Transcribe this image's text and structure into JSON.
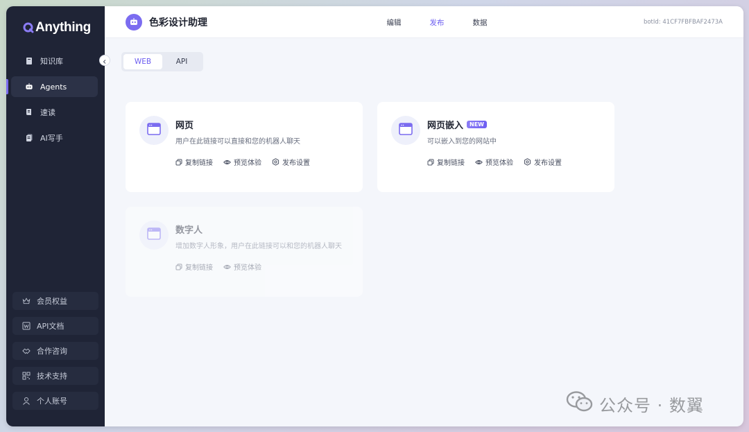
{
  "sidebar": {
    "logo_text": "Anything",
    "items": [
      {
        "label": "知识库",
        "icon": "book-icon",
        "active": false
      },
      {
        "label": "Agents",
        "icon": "robot-icon",
        "active": true
      },
      {
        "label": "速读",
        "icon": "scroll-icon",
        "active": false
      },
      {
        "label": "AI写手",
        "icon": "document-icon",
        "active": false
      }
    ],
    "bottom_items": [
      {
        "label": "会员权益",
        "icon": "crown-icon"
      },
      {
        "label": "API文档",
        "icon": "word-doc-icon"
      },
      {
        "label": "合作咨询",
        "icon": "handshake-icon"
      },
      {
        "label": "技术支持",
        "icon": "qr-code-icon"
      },
      {
        "label": "个人账号",
        "icon": "user-icon"
      }
    ]
  },
  "header": {
    "app_title": "色彩设计助理",
    "tabs": [
      {
        "label": "编辑",
        "active": false
      },
      {
        "label": "发布",
        "active": true
      },
      {
        "label": "数据",
        "active": false
      }
    ],
    "bot_id": "botId: 41CF7FBFBAF2473A"
  },
  "segmented": {
    "options": [
      {
        "label": "WEB",
        "active": true
      },
      {
        "label": "API",
        "active": false
      }
    ]
  },
  "cards": [
    {
      "title": "网页",
      "badge": "",
      "desc": "用户在此链接可以直接和您的机器人聊天",
      "actions": [
        "复制链接",
        "预览体验",
        "发布设置"
      ],
      "disabled": false
    },
    {
      "title": "网页嵌入",
      "badge": "NEW",
      "desc": "可以嵌入到您的网站中",
      "actions": [
        "复制链接",
        "预览体验",
        "发布设置"
      ],
      "disabled": false
    },
    {
      "title": "数字人",
      "badge": "",
      "desc": "增加数字人形象，用户在此链接可以和您的机器人聊天",
      "actions": [
        "复制链接",
        "预览体验"
      ],
      "disabled": true
    }
  ],
  "watermark": {
    "text": "公众号 · 数翼",
    "icon": "wechat-icon"
  },
  "colors": {
    "accent": "#6b5cf0",
    "sidebar_bg": "#1f2436",
    "content_bg": "#f4f6fb"
  }
}
